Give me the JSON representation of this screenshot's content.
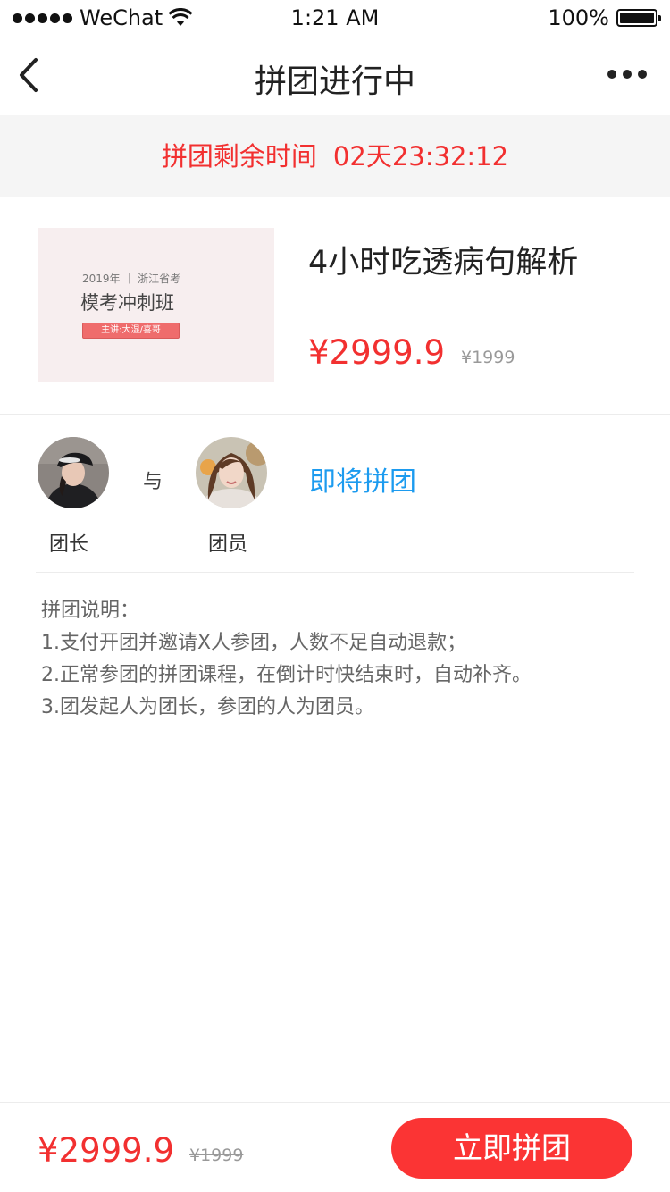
{
  "status_bar": {
    "carrier": "WeChat",
    "time": "1:21 AM",
    "battery": "100%"
  },
  "nav": {
    "title": "拼团进行中"
  },
  "countdown": {
    "label": "拼团剩余时间",
    "time": "02天23:32:12"
  },
  "product": {
    "thumbnail": {
      "year_line": "2019年 ｜ 浙江省考",
      "title": "模考冲刺班",
      "badge": "主讲:大湿/喜哥"
    },
    "title": "4小时吃透病句解析",
    "price": "¥2999.9",
    "original_price": "¥1999"
  },
  "group": {
    "leader_label": "团长",
    "with_text": "与",
    "member_label": "团员",
    "status": "即将拼团"
  },
  "rules": {
    "heading": "拼团说明：",
    "items": [
      "1.支付开团并邀请X人参团，人数不足自动退款；",
      "2.正常参团的拼团课程，在倒计时快结束时，自动补齐。",
      "3.团发起人为团长，参团的人为团员。"
    ]
  },
  "footer": {
    "price": "¥2999.9",
    "original_price": "¥1999",
    "button_label": "立即拼团"
  },
  "colors": {
    "accent_red": "#f23030",
    "button_red": "#fb3434",
    "link_blue": "#1c9bef",
    "countdown_bg": "#f5f5f5"
  },
  "icons": {
    "back": "chevron-left-icon",
    "more": "more-dots-icon",
    "wifi": "wifi-icon",
    "battery": "battery-icon",
    "signal": "signal-icon"
  }
}
